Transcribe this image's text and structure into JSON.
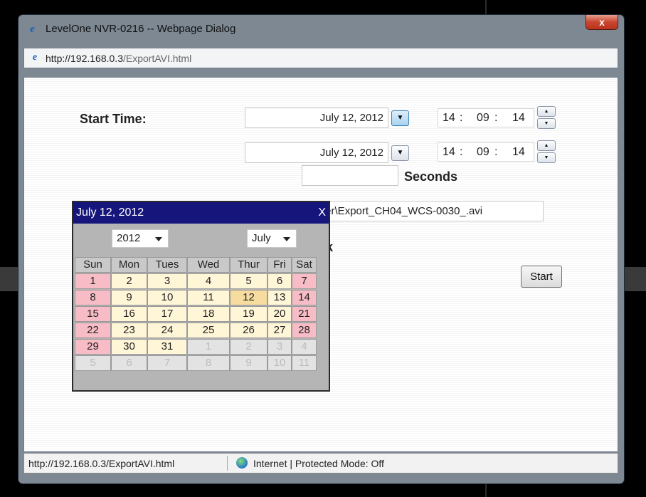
{
  "window": {
    "title": "LevelOne NVR-0216 -- Webpage Dialog",
    "close_label": "x",
    "address": {
      "host": "http://192.168.0.3",
      "path": "/ExportAVI.html"
    }
  },
  "form": {
    "start_time_label": "Start Time:",
    "start_date": "July 12, 2012",
    "start_hour": "14",
    "start_minute": "09",
    "start_second": "14",
    "end_date": "July 12, 2012",
    "end_hour": "14",
    "end_minute": "09",
    "end_second": "14",
    "seconds_label": "Seconds",
    "duration_value": "",
    "file_path": "Folder\\Export_CH04_WCS-0030_.avi",
    "hidden_label_fragment": "k",
    "time_separator": ":",
    "start_button": "Start"
  },
  "calendar": {
    "header_title": "July 12, 2012",
    "close_label": "X",
    "year_selected": "2012",
    "month_selected": "July",
    "day_headers": [
      "Sun",
      "Mon",
      "Tues",
      "Wed",
      "Thur",
      "Fri",
      "Sat"
    ],
    "weeks": [
      [
        "1",
        "2",
        "3",
        "4",
        "5",
        "6",
        "7"
      ],
      [
        "8",
        "9",
        "10",
        "11",
        "12",
        "13",
        "14"
      ],
      [
        "15",
        "16",
        "17",
        "18",
        "19",
        "20",
        "21"
      ],
      [
        "22",
        "23",
        "24",
        "25",
        "26",
        "27",
        "28"
      ],
      [
        "29",
        "30",
        "31",
        "1",
        "2",
        "3",
        "4"
      ],
      [
        "5",
        "6",
        "7",
        "8",
        "9",
        "10",
        "11"
      ]
    ],
    "selected_day": "12"
  },
  "statusbar": {
    "url": "http://192.168.0.3/ExportAVI.html",
    "zone": "Internet | Protected Mode: Off"
  },
  "icons": {
    "page_icon": "ie-icon",
    "zone_icon": "globe-icon"
  },
  "colors": {
    "calendar_header": "#15157c",
    "weekend_cell": "#f7bcc6",
    "weekday_cell": "#fff6d8",
    "selected_cell": "#f7dca0",
    "close_button": "#c9462f"
  }
}
